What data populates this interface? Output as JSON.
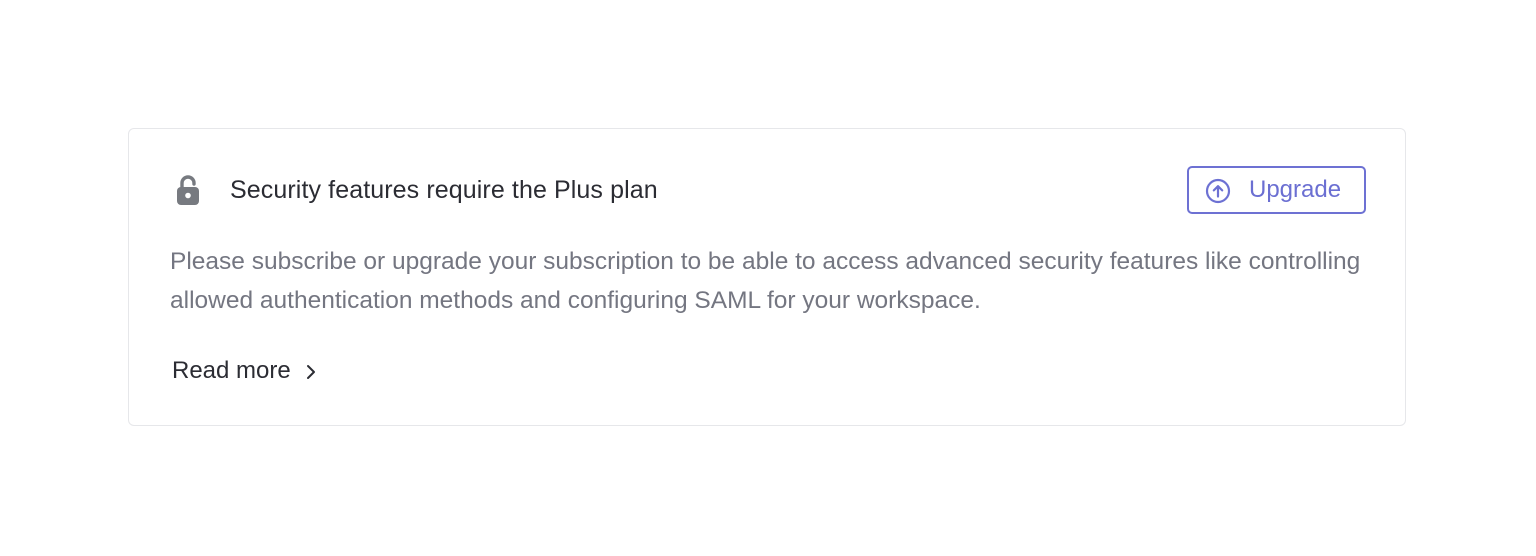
{
  "card": {
    "title": "Security features require the Plus plan",
    "description": "Please subscribe or upgrade your subscription to be able to access advanced security features like controlling allowed authentication methods and configuring SAML for your workspace.",
    "icon": "lock-icon",
    "upgrade_button": {
      "label": "Upgrade",
      "icon": "upgrade-arrow-circle-icon"
    },
    "read_more": {
      "label": "Read more",
      "icon": "chevron-right-icon"
    }
  },
  "colors": {
    "accent": "#6d71d3",
    "text_primary": "#2b2c33",
    "text_secondary": "#747681",
    "icon": "#777a80",
    "border": "#e6e7ea"
  }
}
